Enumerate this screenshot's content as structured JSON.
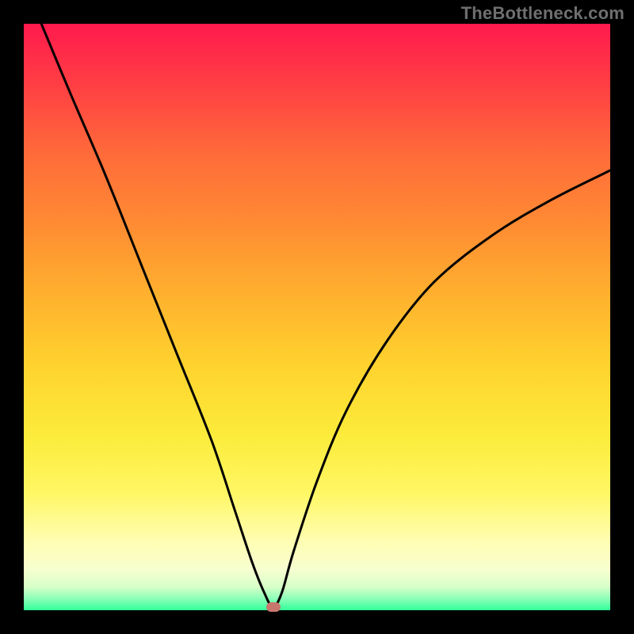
{
  "watermark": "TheBottleneck.com",
  "chart_data": {
    "type": "line",
    "title": "",
    "xlabel": "",
    "ylabel": "",
    "xlim": [
      0,
      100
    ],
    "ylim": [
      0,
      100
    ],
    "grid": false,
    "legend": false,
    "background_gradient": {
      "top": "#ff1a4d",
      "bottom": "#32ff9a",
      "description": "Vertical gradient from red (high mismatch) through orange/yellow to green (optimal)"
    },
    "series": [
      {
        "name": "bottleneck-curve",
        "color": "#000000",
        "x": [
          3,
          8,
          14,
          20,
          26,
          32,
          36,
          39,
          41,
          42.5,
          44,
          46,
          50,
          55,
          62,
          70,
          80,
          90,
          100
        ],
        "y": [
          100,
          88,
          74,
          59,
          44,
          29,
          17,
          8,
          3,
          0.5,
          3,
          10,
          22,
          34,
          46,
          56,
          64,
          70,
          75
        ]
      }
    ],
    "minimum_marker": {
      "x": 42.5,
      "y": 0.5,
      "color": "#c8776f",
      "shape": "rounded-rect"
    },
    "notes": "V-shaped bottleneck curve. Minimum (optimal match) around x≈42.5% on the horizontal axis. Left arm rises steeply to 100; right arm rises more gently to ~75 at x=100."
  }
}
